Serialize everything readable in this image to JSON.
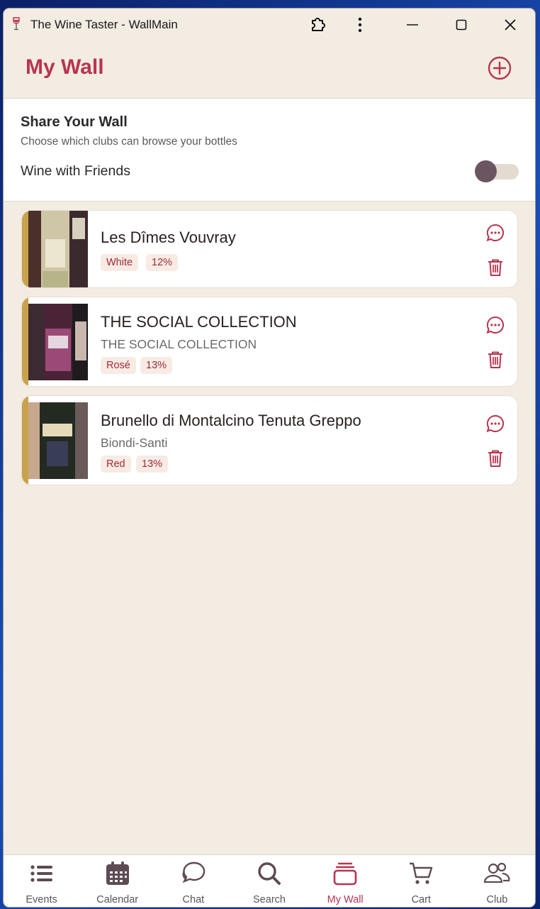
{
  "window": {
    "title": "The Wine Taster - WallMain"
  },
  "header": {
    "title": "My Wall"
  },
  "share": {
    "title": "Share Your Wall",
    "subtitle": "Choose which clubs can browse your bottles",
    "clubs": [
      {
        "name": "Wine with Friends",
        "enabled": false
      }
    ]
  },
  "wines": [
    {
      "name": "Les Dîmes Vouvray",
      "producer": "",
      "type": "White",
      "abv": "12%"
    },
    {
      "name": "THE SOCIAL COLLECTION",
      "producer": "THE SOCIAL COLLECTION",
      "type": "Rosé",
      "abv": "13%"
    },
    {
      "name": "Brunello di Montalcino Tenuta Greppo",
      "producer": "Biondi-Santi",
      "type": "Red",
      "abv": "13%"
    }
  ],
  "nav": {
    "items": [
      {
        "label": "Events",
        "icon": "list-icon"
      },
      {
        "label": "Calendar",
        "icon": "calendar-icon"
      },
      {
        "label": "Chat",
        "icon": "chat-icon"
      },
      {
        "label": "Search",
        "icon": "search-icon"
      },
      {
        "label": "My Wall",
        "icon": "wall-icon",
        "active": true
      },
      {
        "label": "Cart",
        "icon": "cart-icon"
      },
      {
        "label": "Club",
        "icon": "club-icon"
      }
    ]
  },
  "colors": {
    "accent": "#b8344f",
    "background": "#f3ece3",
    "card_stripe": "#c9a24c",
    "chip_bg": "#f7ebe3"
  }
}
